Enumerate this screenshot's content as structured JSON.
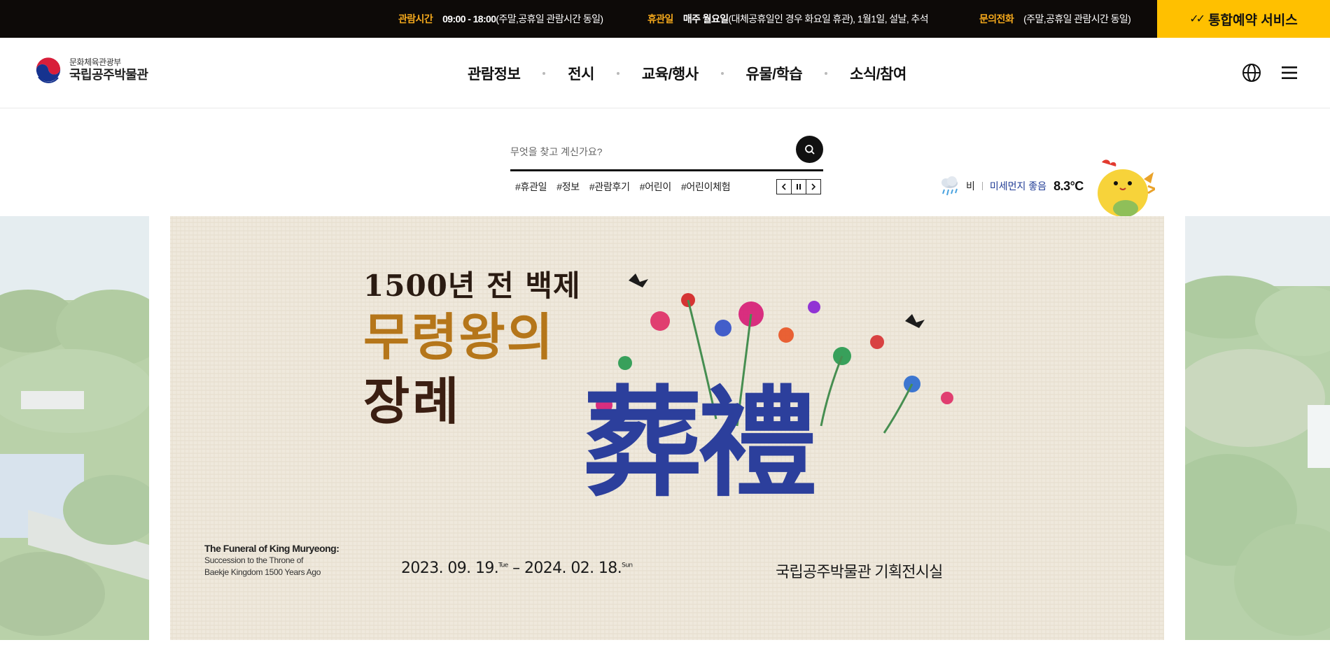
{
  "topbar": {
    "hours_label": "관람시간",
    "hours_time": "09:00 - 18:00",
    "hours_note": "(주말,공휴일 관람시간 동일)",
    "closed_label": "휴관일",
    "closed_day": "매주 월요일",
    "closed_note": "(대체공휴일인 경우 화요일 휴관), 1월1일, 설날, 추석",
    "phone_label": "문의전화",
    "phone_note": "(주말,공휴일 관람시간 동일)",
    "booking_label": "통합예약 서비스"
  },
  "header": {
    "logo_ministry": "문화체육관광부",
    "logo_name": "국립공주박물관",
    "nav": [
      "관람정보",
      "전시",
      "교육/행사",
      "유물/학습",
      "소식/참여"
    ]
  },
  "search": {
    "placeholder": "무엇을 찾고 계신가요?",
    "tags": [
      "#휴관일",
      "#정보",
      "#관람후기",
      "#어린이",
      "#어린이체험"
    ]
  },
  "weather": {
    "condition": "비",
    "dust": "미세먼지 좋음",
    "temp": "8.3°C"
  },
  "banner": {
    "title_line1": "1500년 전 백제",
    "title_line2": "무령왕의",
    "title_line3": "장례",
    "title_hanja": "葬禮",
    "subtitle_en_title": "The Funeral of King Muryeong:",
    "subtitle_en_line1": "Succession to the Throne of",
    "subtitle_en_line2": "Baekje Kingdom 1500 Years Ago",
    "period_start": "2023. 09. 19.",
    "period_start_day": "Tue",
    "period_dash": "–",
    "period_end": "2024. 02. 18.",
    "period_end_day": "Sun",
    "venue": "국립공주박물관 기획전시실"
  },
  "colors": {
    "topbar_bg": "#0d0a08",
    "accent_yellow": "#ffc000",
    "label_orange": "#f3a81c",
    "dust_blue": "#1f3b95"
  }
}
